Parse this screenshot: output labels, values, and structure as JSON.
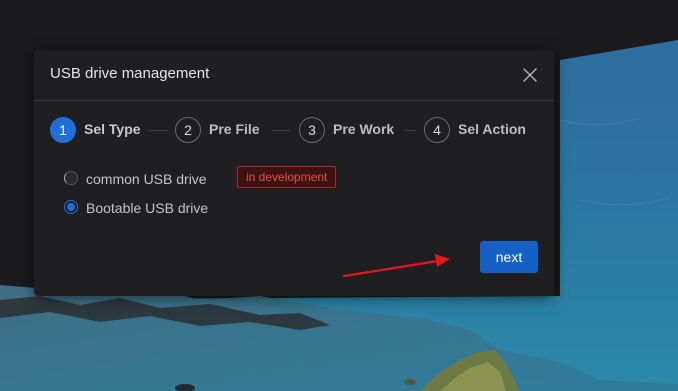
{
  "dialog": {
    "title": "USB drive management",
    "close_icon": "close-icon"
  },
  "steps": [
    {
      "number": "1",
      "label": "Sel Type",
      "active": true
    },
    {
      "number": "2",
      "label": "Pre File",
      "active": false
    },
    {
      "number": "3",
      "label": "Pre Work",
      "active": false
    },
    {
      "number": "4",
      "label": "Sel Action",
      "active": false
    }
  ],
  "options": [
    {
      "label": "common USB drive",
      "badge": "in development",
      "checked": false,
      "disabled": true
    },
    {
      "label": "Bootable USB drive",
      "checked": true,
      "disabled": false
    }
  ],
  "actions": {
    "next_label": "next"
  },
  "colors": {
    "accent": "#1e6fd9",
    "button": "#1560c4",
    "warning": "#ef4a43",
    "annotation_arrow": "#e8161b"
  }
}
